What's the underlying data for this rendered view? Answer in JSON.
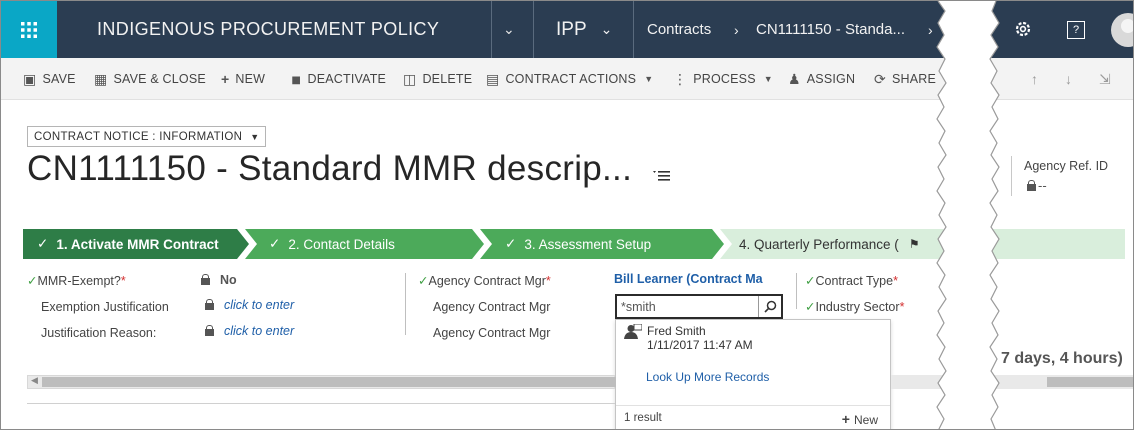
{
  "app": {
    "title": "INDIGENOUS PROCUREMENT POLICY",
    "area": "IPP"
  },
  "breadcrumb": {
    "entity": "Contracts",
    "record": "CN1111150 - Standa..."
  },
  "commands": {
    "save": "SAVE",
    "save_close": "SAVE & CLOSE",
    "new": "NEW",
    "deactivate": "DEACTIVATE",
    "delete": "DELETE",
    "contract_actions": "CONTRACT ACTIONS",
    "process": "PROCESS",
    "assign": "ASSIGN",
    "share": "SHARE"
  },
  "form": {
    "selector": "CONTRACT NOTICE : INFORMATION",
    "title": "CN1111150 - Standard MMR descrip...",
    "agency_ref_label": "Agency Ref. ID",
    "agency_ref_value": "--"
  },
  "process": {
    "stages": [
      {
        "label": "1. Activate MMR Contract",
        "state": "active"
      },
      {
        "label": "2. Contact Details",
        "state": "complete"
      },
      {
        "label": "3. Assessment Setup",
        "state": "complete"
      },
      {
        "label": "4. Quarterly Performance (",
        "state": "pending"
      }
    ]
  },
  "fields": {
    "col1": {
      "mmr_exempt_label": "MMR-Exempt?",
      "mmr_exempt_value": "No",
      "exemption_label": "Exemption Justification",
      "exemption_value": "click to enter",
      "reason_label": "Justification Reason:",
      "reason_value": "click to enter"
    },
    "col2": {
      "agency_mgr_label": "Agency Contract Mgr",
      "agency_mgr_value": "Bill Learner (Contract Ma",
      "agency_mgr2_label": "Agency Contract Mgr",
      "agency_mgr3_label": "Agency Contract Mgr",
      "lookup_value": "*smith"
    },
    "col3": {
      "contract_type_label": "Contract Type",
      "industry_sector_label": "Industry Sector"
    }
  },
  "lookup_results": {
    "items": [
      {
        "name": "Fred Smith",
        "date": "1/11/2017 11:47 AM"
      }
    ],
    "more_link": "Look Up More Records",
    "count": "1 result",
    "new_label": "New"
  },
  "overflow_text": "7 days, 4 hours)",
  "colors": {
    "nav_bg": "#2b3d52",
    "waffle_bg": "#0aa7c6",
    "stage_active": "#2e7d47",
    "stage_complete": "#4caa5a",
    "stage_pending": "#d9eedc",
    "required": "#d32f2f",
    "link": "#1f5fa8"
  }
}
